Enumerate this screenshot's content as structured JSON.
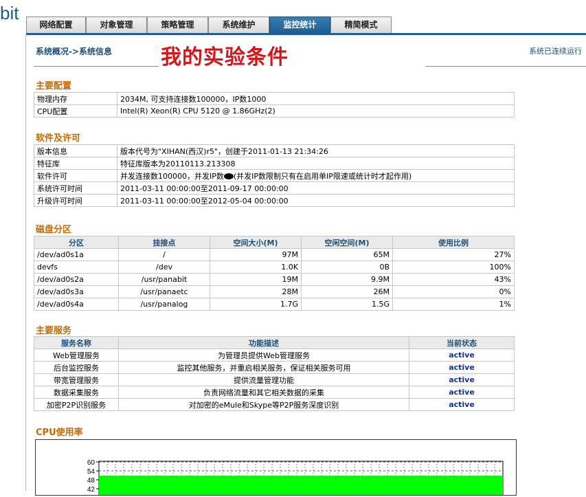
{
  "logo": {
    "text": "bit"
  },
  "tabs": [
    {
      "label": "网络配置",
      "active": false
    },
    {
      "label": "对象管理",
      "active": false
    },
    {
      "label": "策略管理",
      "active": false
    },
    {
      "label": "系统维护",
      "active": false
    },
    {
      "label": "监控统计",
      "active": true
    },
    {
      "label": "精简模式",
      "active": false
    }
  ],
  "header": {
    "breadcrumb": "系统概况->系统信息",
    "annotation": "我的实验条件",
    "uptime": "系统已连续运行"
  },
  "main_config": {
    "title": "主要配置",
    "rows": [
      {
        "key": "物理内存",
        "value": "2034M, 可支持连接数100000，IP数1000"
      },
      {
        "key": "CPU配置",
        "value": "Intel(R) Xeon(R) CPU 5120 @ 1.86GHz(2)"
      }
    ]
  },
  "software": {
    "title": "软件及许可",
    "rows": [
      {
        "key": "版本信息",
        "value": "版本代号为\"XIHAN(西汉)r5\"，创建于2011-01-13 21:34:26"
      },
      {
        "key": "特征库",
        "value": "特征库版本为20110113.213308"
      },
      {
        "key": "软件许可",
        "value_a": "并发连接数100000，并发IP数",
        "value_b": "(并发IP数限制只有在启用单IP限速或统计时才起作用)"
      },
      {
        "key": "系统许可时间",
        "value": "2011-03-11 00:00:00至2011-09-17 00:00:00"
      },
      {
        "key": "升级许可时间",
        "value": "2011-03-11 00:00:00至2012-05-04 00:00:00"
      }
    ]
  },
  "disk": {
    "title": "磁盘分区",
    "headers": [
      "分区",
      "挂接点",
      "空间大小(M)",
      "空闲空间(M)",
      "使用比例"
    ],
    "rows": [
      [
        "/dev/ad0s1a",
        "/",
        "97M",
        "65M",
        "27%"
      ],
      [
        "devfs",
        "/dev",
        "1.0K",
        "0B",
        "100%"
      ],
      [
        "/dev/ad0s2a",
        "/usr/panabit",
        "19M",
        "9.9M",
        "43%"
      ],
      [
        "/dev/ad0s3a",
        "/usr/panaetc",
        "28M",
        "26M",
        "0%"
      ],
      [
        "/dev/ad0s4a",
        "/usr/panalog",
        "1.7G",
        "1.5G",
        "1%"
      ]
    ]
  },
  "services": {
    "title": "主要服务",
    "headers": [
      "服务名称",
      "功能描述",
      "当前状态"
    ],
    "rows": [
      [
        "Web管理服务",
        "为管理员提供Web管理服务",
        "active"
      ],
      [
        "后台监控服务",
        "监控其他服务，并重启相关服务，保证相关服务可用",
        "active"
      ],
      [
        "带宽管理服务",
        "提供流量管理功能",
        "active"
      ],
      [
        "数据采集服务",
        "负责网络流量和其它相关数据的采集",
        "active"
      ],
      [
        "加密P2P识别服务",
        "对加密的eMule和Skype等P2P服务深度识别",
        "active"
      ]
    ]
  },
  "cpu": {
    "title": "CPU使用率",
    "y_ticks": [
      "60",
      "54",
      "48",
      "42"
    ]
  },
  "colors": {
    "accent": "#1d5d92",
    "section_title": "#c56a00",
    "annotation": "#d4161b",
    "cpu_fill": "#00ff00",
    "status": "#13309a"
  }
}
